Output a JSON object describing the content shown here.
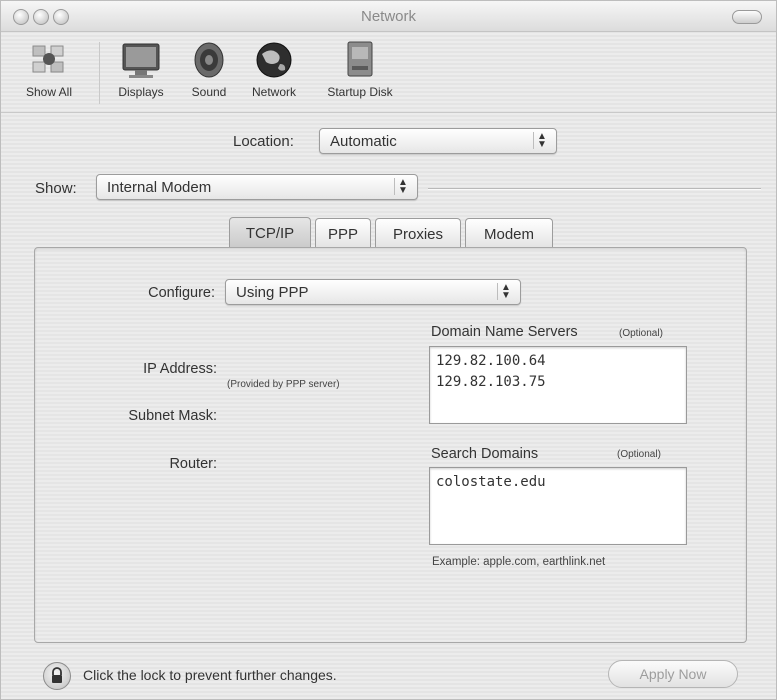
{
  "window": {
    "title": "Network"
  },
  "toolbar": {
    "items": [
      {
        "label": "Show All",
        "icon": "apple-icon"
      },
      {
        "label": "Displays",
        "icon": "display-icon"
      },
      {
        "label": "Sound",
        "icon": "speaker-icon"
      },
      {
        "label": "Network",
        "icon": "globe-icon"
      },
      {
        "label": "Startup Disk",
        "icon": "disk-icon"
      }
    ]
  },
  "location": {
    "label": "Location:",
    "value": "Automatic"
  },
  "show": {
    "label": "Show:",
    "value": "Internal Modem"
  },
  "tabs": [
    {
      "label": "TCP/IP",
      "active": true
    },
    {
      "label": "PPP",
      "active": false
    },
    {
      "label": "Proxies",
      "active": false
    },
    {
      "label": "Modem",
      "active": false
    }
  ],
  "tcpip": {
    "configure_label": "Configure:",
    "configure_value": "Using PPP",
    "ip_address_label": "IP Address:",
    "provided_note": "(Provided by PPP server)",
    "subnet_mask_label": "Subnet Mask:",
    "router_label": "Router:",
    "dns_label": "Domain Name Servers",
    "dns_optional": "(Optional)",
    "dns_values": [
      "129.82.100.64",
      "129.82.103.75"
    ],
    "search_domains_label": "Search Domains",
    "search_optional": "(Optional)",
    "search_domains_values": [
      "colostate.edu"
    ],
    "example_text": "Example: apple.com, earthlink.net"
  },
  "footer": {
    "lock_text": "Click the lock to prevent further changes.",
    "apply_label": "Apply Now"
  }
}
